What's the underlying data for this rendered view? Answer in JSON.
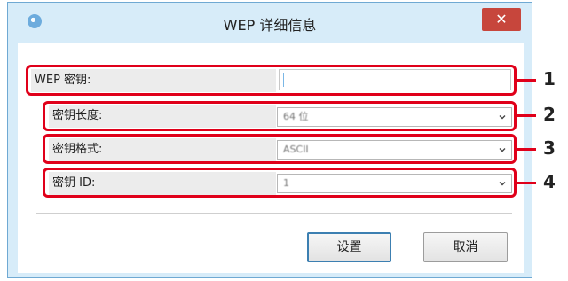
{
  "window": {
    "title": "WEP 详细信息",
    "close_glyph": "✕"
  },
  "form": {
    "wep_key": {
      "label": "WEP 密钥:",
      "value": ""
    },
    "key_length": {
      "label": "密钥长度:",
      "value": "64 位"
    },
    "key_format": {
      "label": "密钥格式:",
      "value": "ASCII"
    },
    "key_id": {
      "label": "密钥 ID:",
      "value": "1"
    }
  },
  "callouts": [
    "1",
    "2",
    "3",
    "4"
  ],
  "buttons": {
    "ok_label": "设置",
    "cancel_label": "取消"
  },
  "colors": {
    "highlight": "#e0001a",
    "close_button": "#c7463c",
    "frame": "#d7ecf9"
  },
  "icons": [
    "app-icon",
    "close-icon",
    "chevron-down-icon"
  ]
}
